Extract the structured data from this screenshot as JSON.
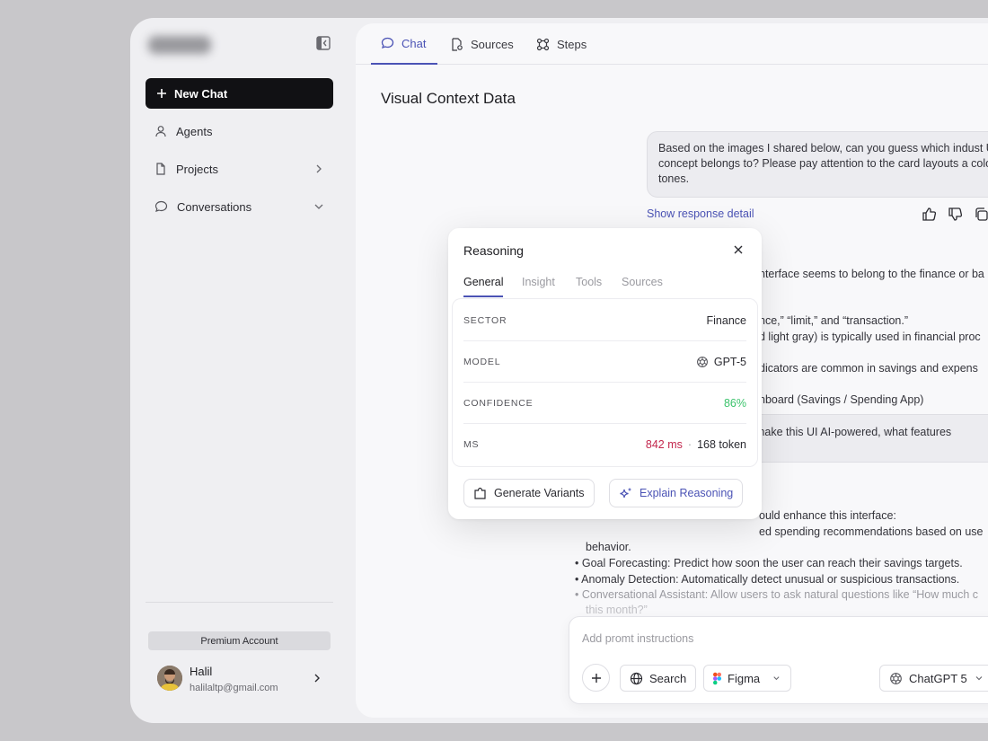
{
  "sidebar": {
    "new_chat_label": "New Chat",
    "items": [
      {
        "label": "Agents"
      },
      {
        "label": "Projects"
      },
      {
        "label": "Conversations"
      }
    ],
    "premium_label": "Premium Account",
    "user": {
      "name": "Halil",
      "email": "halilaltp@gmail.com"
    }
  },
  "main": {
    "tabs": [
      {
        "label": "Chat",
        "active": true
      },
      {
        "label": "Sources",
        "active": false
      },
      {
        "label": "Steps",
        "active": false
      }
    ],
    "title": "Visual Context Data",
    "user_message": "Based on the images I shared below, can you guess which indust UI concept belongs to? Please pay attention to the card layouts a color tones.",
    "show_response_label": "Show response detail",
    "response_lines": [
      "nterface seems to belong to the finance or ba",
      "nce,” “limit,” and “transaction.”",
      "d light gray) is typically used in financial proc",
      "dicators are common in savings and expens",
      "nboard (Savings / Spending App)"
    ],
    "followup_message": "make this UI AI-powered, what features",
    "response2_lines": [
      "ould enhance this interface:",
      "ed spending recommendations based on use",
      "behavior.",
      "Goal Forecasting: Predict how soon the user can reach their savings targets.",
      "Anomaly Detection: Automatically detect unusual or suspicious transactions.",
      "Conversational Assistant: Allow users to ask natural questions like “How much c",
      "this month?”"
    ],
    "composer": {
      "placeholder": "Add promt instructions",
      "search_label": "Search",
      "figma_label": "Figma",
      "model_label": "ChatGPT 5"
    }
  },
  "popup": {
    "title": "Reasoning",
    "tabs": [
      "General",
      "Insight",
      "Tools",
      "Sources"
    ],
    "rows": {
      "sector": {
        "label": "SECTOR",
        "value": "Finance"
      },
      "model": {
        "label": "MODEL",
        "value": "GPT-5"
      },
      "confidence": {
        "label": "CONFIDENCE",
        "value": "86%"
      },
      "ms": {
        "label": "MS",
        "ms_value": "842 ms",
        "separator": "·",
        "token_value": "168 token"
      }
    },
    "generate_label": "Generate Variants",
    "explain_label": "Explain Reasoning"
  },
  "colors": {
    "accent": "#4b53b5",
    "confidence": "#3cc36c",
    "ms": "#c3274d"
  }
}
